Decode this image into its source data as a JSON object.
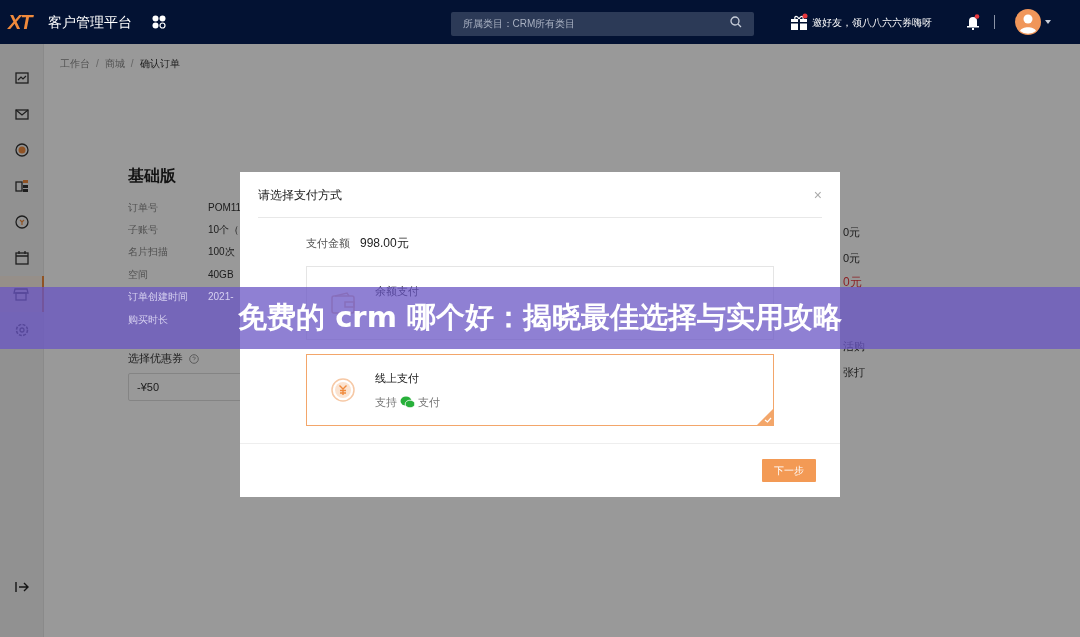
{
  "header": {
    "logo": "XT",
    "title": "客户管理平台",
    "search": {
      "placeholder": "所属类目：CRM所有类目"
    },
    "invite": "邀好友，领八八六六券嗨呀",
    "gift_badge": true,
    "bell_badge": true
  },
  "sidebar": {
    "items": [
      {
        "kind": "chart",
        "selected": false
      },
      {
        "kind": "mail",
        "selected": false
      },
      {
        "kind": "coin",
        "selected": false
      },
      {
        "kind": "cards",
        "selected": false
      },
      {
        "kind": "refund",
        "selected": false
      },
      {
        "kind": "calendar",
        "selected": false
      },
      {
        "kind": "store",
        "selected": true
      },
      {
        "kind": "settings",
        "selected": false
      }
    ]
  },
  "breadcrumb": [
    {
      "kind": "link",
      "text": "工作台"
    },
    {
      "kind": "separator",
      "text": "/"
    },
    {
      "kind": "link",
      "text": "商城"
    },
    {
      "kind": "separator",
      "text": "/"
    },
    {
      "kind": "current",
      "text": "确认订单"
    }
  ],
  "plan": {
    "title": "基础版",
    "rows": [
      {
        "label": "订单号",
        "value": "POM11"
      },
      {
        "label": "子账号",
        "value": "10个（"
      },
      {
        "label": "名片扫描",
        "value": "100次"
      },
      {
        "label": "空间",
        "value": "40GB"
      },
      {
        "label": "订单创建时间",
        "value": "2021-"
      },
      {
        "label": "购买时长"
      }
    ],
    "coupon_label": "选择优惠券",
    "coupon_value": "-¥50"
  },
  "summary": [
    {
      "text": "0元",
      "kind": "normal"
    },
    {
      "text": "0元",
      "kind": "normal"
    },
    {
      "text": "0元",
      "kind": "red"
    },
    {
      "text": "活购",
      "kind": "normal"
    },
    {
      "text": "张打",
      "kind": "normal"
    }
  ],
  "dialog": {
    "title": "请选择支付方式",
    "close": "×",
    "amount_label": "支付金额",
    "amount": "998.00元",
    "options": [
      {
        "kind": "wallet",
        "title": "余额支付",
        "selected": false
      },
      {
        "kind": "online",
        "title": "线上支付",
        "note_before": "支持",
        "note_after": "支付",
        "selected": true
      }
    ],
    "next": "下一步"
  },
  "banner": "免费的 crm 哪个好：揭晓最佳选择与实用攻略"
}
